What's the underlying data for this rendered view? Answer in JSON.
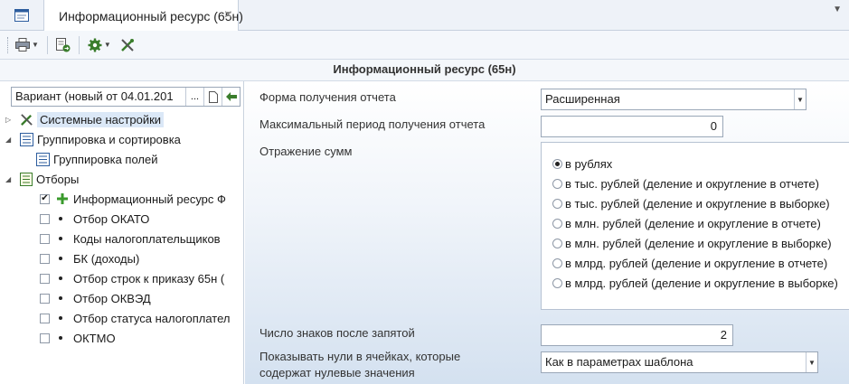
{
  "tabs": {
    "home_icon": "window-icon",
    "document_title": "Информационный ресурс (65н)",
    "close_glyph": "×",
    "dropdown_glyph": "▼"
  },
  "toolbar": {
    "buttons": [
      "printer-icon",
      "export-icon",
      "settings-gear-icon",
      "tools-icon"
    ]
  },
  "header": {
    "title": "Информационный ресурс (65н)"
  },
  "left_panel": {
    "variant_value": "Вариант (новый от 04.01.201",
    "variant_more": "...",
    "tree": [
      {
        "label": "Системные настройки",
        "icon": "tools-icon",
        "expander": "▷",
        "selected": true
      },
      {
        "label": "Группировка и сортировка",
        "icon": "grouping-icon",
        "expander": "◢"
      },
      {
        "label": "Группировка полей",
        "icon": "grouping-icon"
      },
      {
        "label": "Отборы",
        "icon": "filter-list-icon",
        "expander": "◢"
      },
      {
        "label": "Информационный ресурс Ф",
        "icon": "add-icon",
        "checked": true,
        "check_glyph": "✔"
      },
      {
        "label": "Отбор ОКАТО",
        "checked": false
      },
      {
        "label": "Коды налогоплательщиков",
        "checked": false
      },
      {
        "label": "БК (доходы)",
        "checked": false
      },
      {
        "label": "Отбор строк к приказу 65н (",
        "checked": false
      },
      {
        "label": "Отбор ОКВЭД",
        "checked": false
      },
      {
        "label": "Отбор статуса налогоплател",
        "checked": false
      },
      {
        "label": "ОКТМО",
        "checked": false
      }
    ]
  },
  "settings": {
    "report_form_label": "Форма получения отчета",
    "report_form_value": "Расширенная",
    "max_period_label": "Максимальный период получения отчета",
    "max_period_value": "0",
    "sums_label": "Отражение сумм",
    "sums_options": [
      "в рублях",
      "в тыс. рублей (деление и округление в отчете)",
      "в тыс. рублей (деление и округление в выборке)",
      "в млн. рублей (деление и округление в отчете)",
      "в млн. рублей (деление и округление в выборке)",
      "в млрд. рублей (деление и округление в отчете)",
      "в млрд. рублей (деление и округление в выборке)"
    ],
    "sums_selected_index": 0,
    "decimals_label": "Число знаков после запятой",
    "decimals_value": "2",
    "zeros_label_line1": "Показывать нули в ячейках, которые",
    "zeros_label_line2": "содержат нулевые значения",
    "zeros_value": "Как в параметрах шаблона"
  },
  "colors": {
    "accent": "#3a7d2c",
    "selection": "#dbe8f7"
  }
}
